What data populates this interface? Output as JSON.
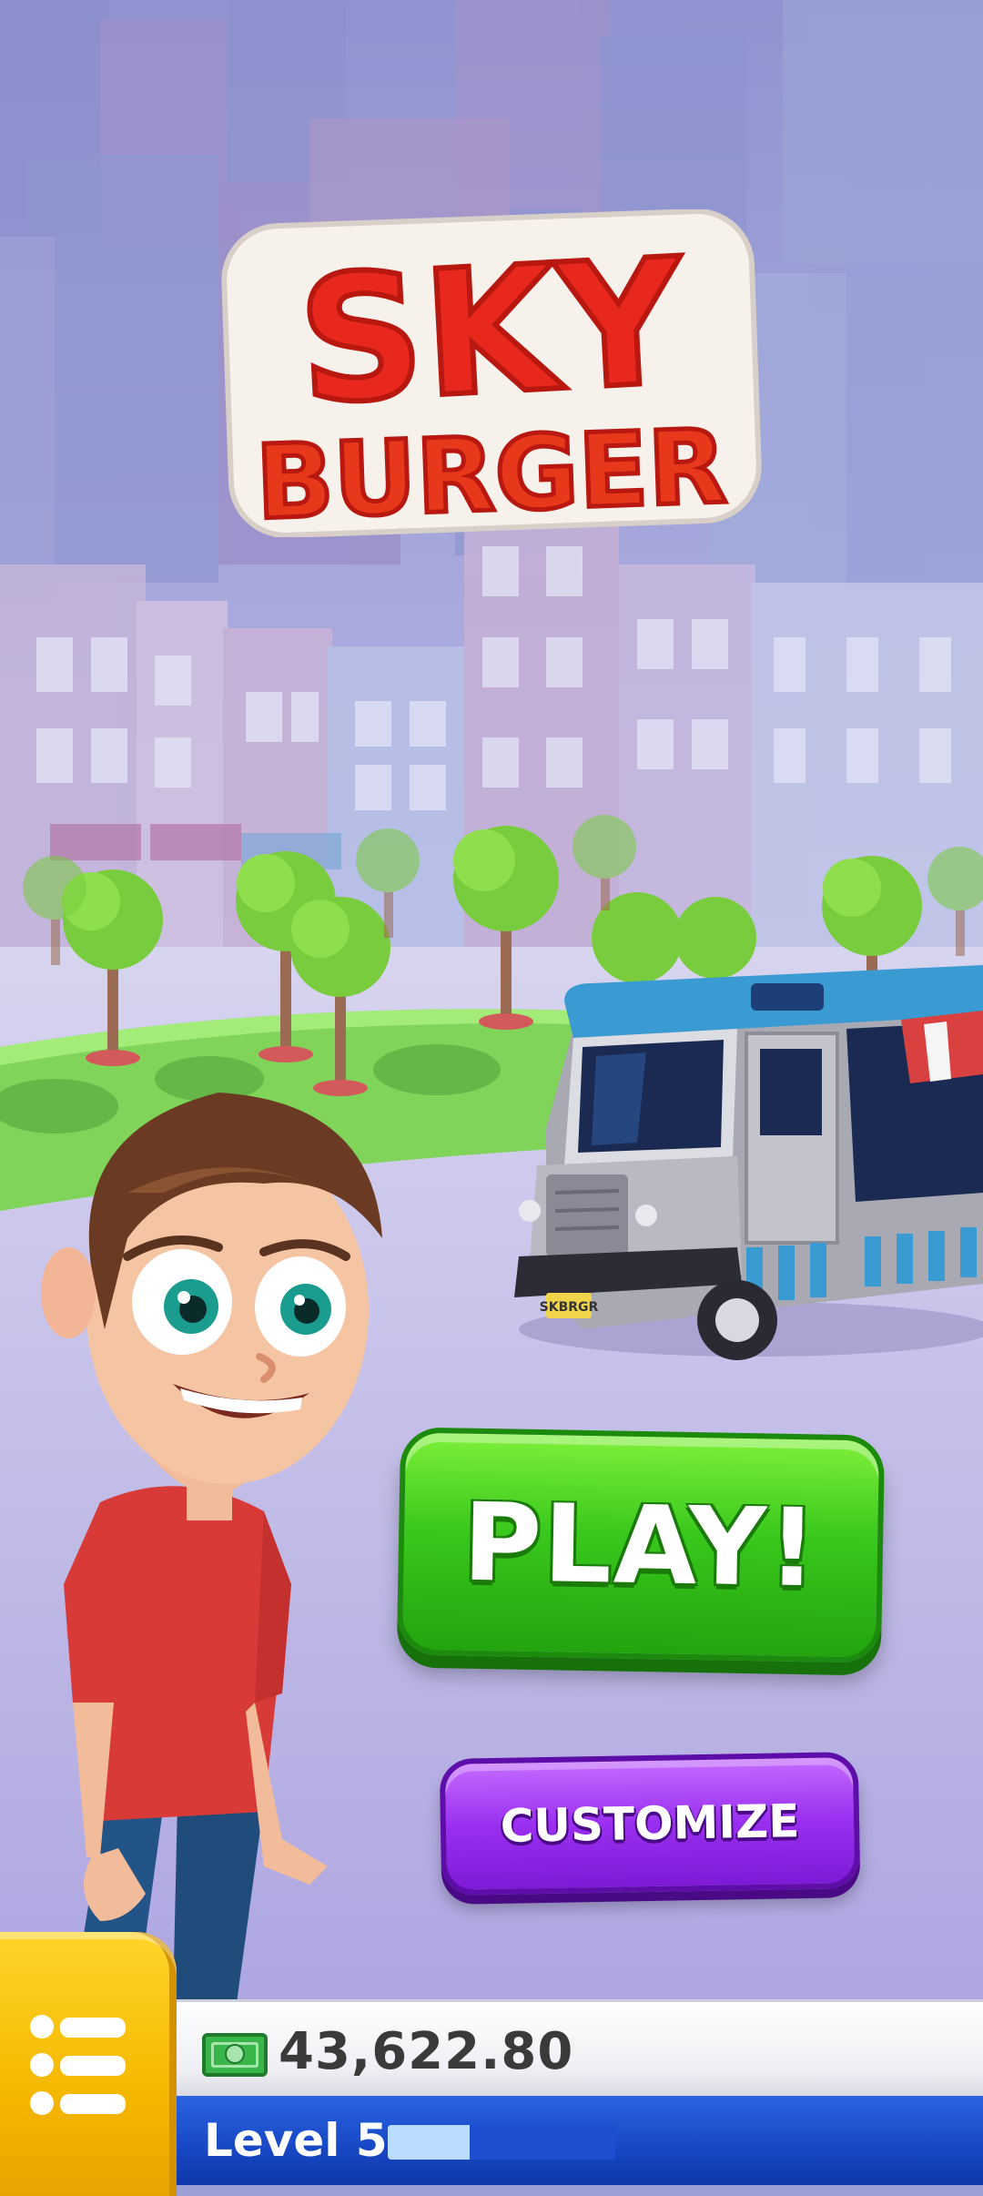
{
  "title": {
    "line1": "SKY",
    "line2": "BURGER"
  },
  "buttons": {
    "play": "PLAY!",
    "customize": "CUSTOMIZE"
  },
  "truck": {
    "plate": "SKBRGR"
  },
  "hud": {
    "menu_icon": "menu-list-icon",
    "cash_icon": "cash-bill-icon",
    "cash": "43,622.80",
    "level": "Level 5",
    "level_progress": 0.36
  },
  "colors": {
    "play": "#39c81c",
    "customize": "#9a2ff0",
    "menu": "#f5b800",
    "level_bar": "#1747c4",
    "title_red": "#e8281c"
  }
}
